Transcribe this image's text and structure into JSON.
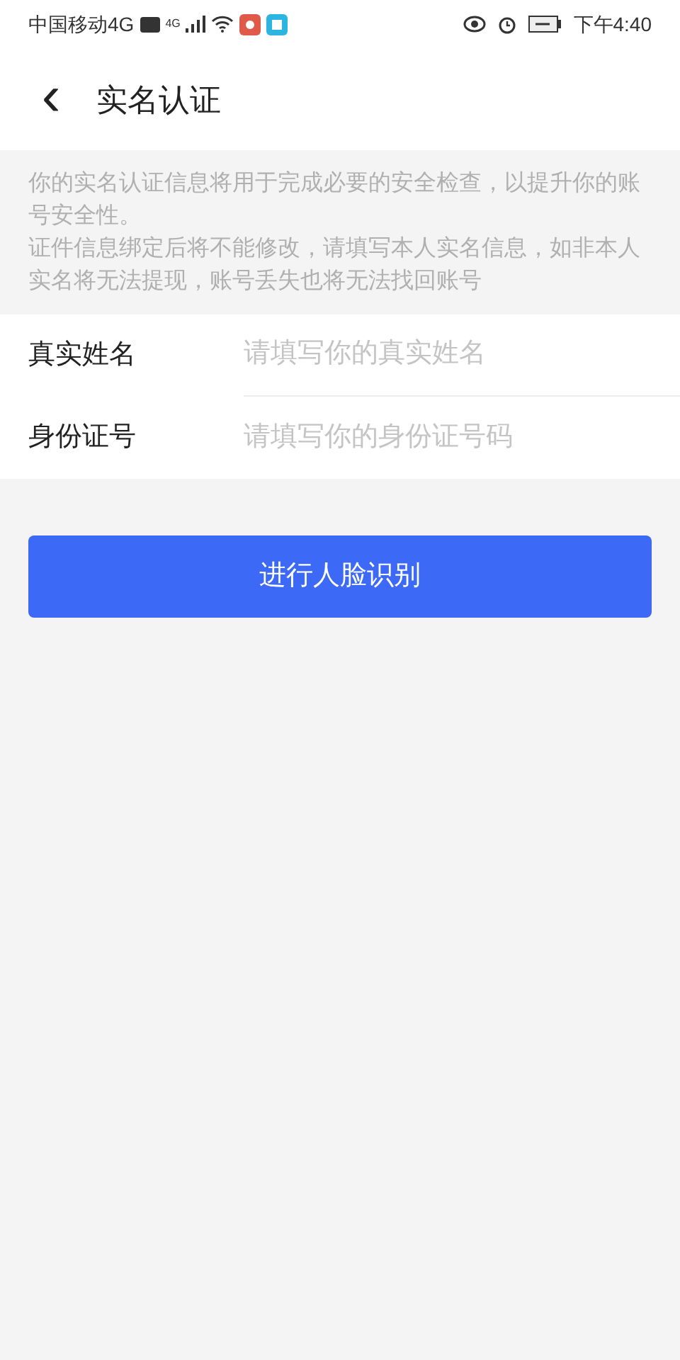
{
  "status_bar": {
    "carrier": "中国移动4G",
    "network": "4G",
    "time": "下午4:40"
  },
  "header": {
    "back": "‹",
    "title": "实名认证"
  },
  "notice": [
    "你的实名认证信息将用于完成必要的安全检查，以提升你的账号安全性。",
    "证件信息绑定后将不能修改，请填写本人实名信息，如非本人实名将无法提现，账号丢失也将无法找回账号"
  ],
  "fields": [
    {
      "label": "真实姓名",
      "placeholder": "请填写你的真实姓名"
    },
    {
      "label": "身份证号",
      "placeholder": "请填写你的身份证号码"
    }
  ],
  "button": "进行人脸识别"
}
